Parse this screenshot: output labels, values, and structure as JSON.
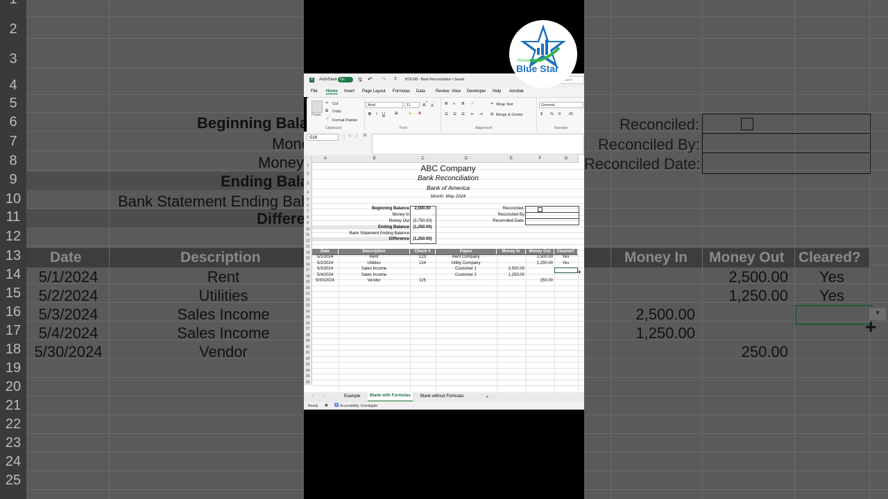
{
  "background": {
    "row_numbers": [
      "1",
      "2",
      "3",
      "4",
      "5",
      "6",
      "7",
      "8",
      "9",
      "10",
      "11",
      "12",
      "13",
      "14",
      "15",
      "16",
      "17",
      "18",
      "19",
      "20",
      "21",
      "22",
      "23",
      "24",
      "25"
    ],
    "labels": {
      "beginning": "Beginning Bala",
      "money_in": "Mone",
      "money_out": "Money",
      "ending": "Ending Bala",
      "bank_statement": "Bank Statement Ending Bal",
      "difference": "Differe",
      "reconciled": "Reconciled:",
      "reconciled_by": "Reconciled By:",
      "reconciled_date": "Reconciled Date:"
    },
    "headers": {
      "date": "Date",
      "description": "Description",
      "money_in": "Money In",
      "money_out": "Money Out",
      "cleared": "Cleared?"
    },
    "rows": [
      {
        "date": "5/1/2024",
        "desc": "Rent",
        "in": "",
        "out": "2,500.00",
        "cleared": "Yes"
      },
      {
        "date": "5/2/2024",
        "desc": "Utilities",
        "in": "",
        "out": "1,250.00",
        "cleared": "Yes"
      },
      {
        "date": "5/3/2024",
        "desc": "Sales Income",
        "in": "2,500.00",
        "out": "",
        "cleared": ""
      },
      {
        "date": "5/4/2024",
        "desc": "Sales Income",
        "in": "1,250.00",
        "out": "",
        "cleared": ""
      },
      {
        "date": "5/30/2024",
        "desc": "Vendor",
        "in": "",
        "out": "250.00",
        "cleared": ""
      }
    ]
  },
  "logo": {
    "tagline": "Presented by",
    "name": "Blue Star",
    "accent": "#1e6fbf",
    "swoosh": "#2fb34a"
  },
  "titlebar": {
    "autosave": "AutoSave",
    "toggle": "On",
    "filename": "BTE108 - Bank Reconciliation • Saved",
    "search": "Search"
  },
  "menu": [
    "File",
    "Home",
    "Insert",
    "Page Layout",
    "Formulas",
    "Data",
    "Review",
    "View",
    "Developer",
    "Help",
    "Acrobat"
  ],
  "ribbon": {
    "paste": "Paste",
    "cut": "Cut",
    "copy": "Copy",
    "format_painter": "Format Painter",
    "clipboard": "Clipboard",
    "font_name": "Arial",
    "font_size": "11",
    "font_group": "Font",
    "wrap_text": "Wrap Text",
    "merge_center": "Merge & Center",
    "alignment": "Alignment",
    "number_format": "General",
    "number": "Number"
  },
  "formula_bar": {
    "name_box": "G16",
    "fx": "fx",
    "content": ""
  },
  "columns": [
    "A",
    "B",
    "C",
    "D",
    "E",
    "F",
    "G"
  ],
  "sheet": {
    "company": "ABC Company",
    "title": "Bank Reconciliation",
    "bank": "Bank of America",
    "month": "Month: May 2024",
    "summary": [
      {
        "label": "Beginning Balance",
        "value": "2,500.00",
        "bold": true
      },
      {
        "label": "Money In",
        "value": "-",
        "bold": false
      },
      {
        "label": "Money Out",
        "value": "(3,750.00)",
        "bold": false
      },
      {
        "label": "Ending Balance",
        "value": "(1,250.00)",
        "bold": true
      },
      {
        "label": "Bank Statement Ending Balance",
        "value": "",
        "bold": false
      },
      {
        "label": "Difference",
        "value": "(1,250.00)",
        "bold": true
      }
    ],
    "reconciled": "Reconciled:",
    "reconciled_by": "Reconciled By",
    "reconciled_date": "Reconciled Date:",
    "table_headers": [
      "Date",
      "Description",
      "Check #",
      "Payee",
      "Money In",
      "Money Out",
      "Cleared?"
    ],
    "rows": [
      {
        "date": "5/1/2024",
        "desc": "Rent",
        "check": "123",
        "payee": "Rent Company",
        "in": "",
        "out": "2,500.00",
        "cleared": "Yes"
      },
      {
        "date": "5/2/2024",
        "desc": "Utilities",
        "check": "124",
        "payee": "Utility Company",
        "in": "",
        "out": "1,250.00",
        "cleared": "Yes"
      },
      {
        "date": "5/3/2024",
        "desc": "Sales Income",
        "check": "",
        "payee": "Customer 1",
        "in": "2,500.00",
        "out": "",
        "cleared": ""
      },
      {
        "date": "5/4/2024",
        "desc": "Sales Income",
        "check": "",
        "payee": "Customer 2",
        "in": "1,250.00",
        "out": "",
        "cleared": ""
      },
      {
        "date": "5/30/2024",
        "desc": "Vendor",
        "check": "125",
        "payee": "",
        "in": "",
        "out": "250.00",
        "cleared": ""
      }
    ]
  },
  "tabs": [
    "Example",
    "Blank with Formulas",
    "Blank without Formulas"
  ],
  "active_tab": "Blank with Formulas",
  "status": {
    "ready": "Ready",
    "accessibility": "Accessibility: Investigate"
  }
}
